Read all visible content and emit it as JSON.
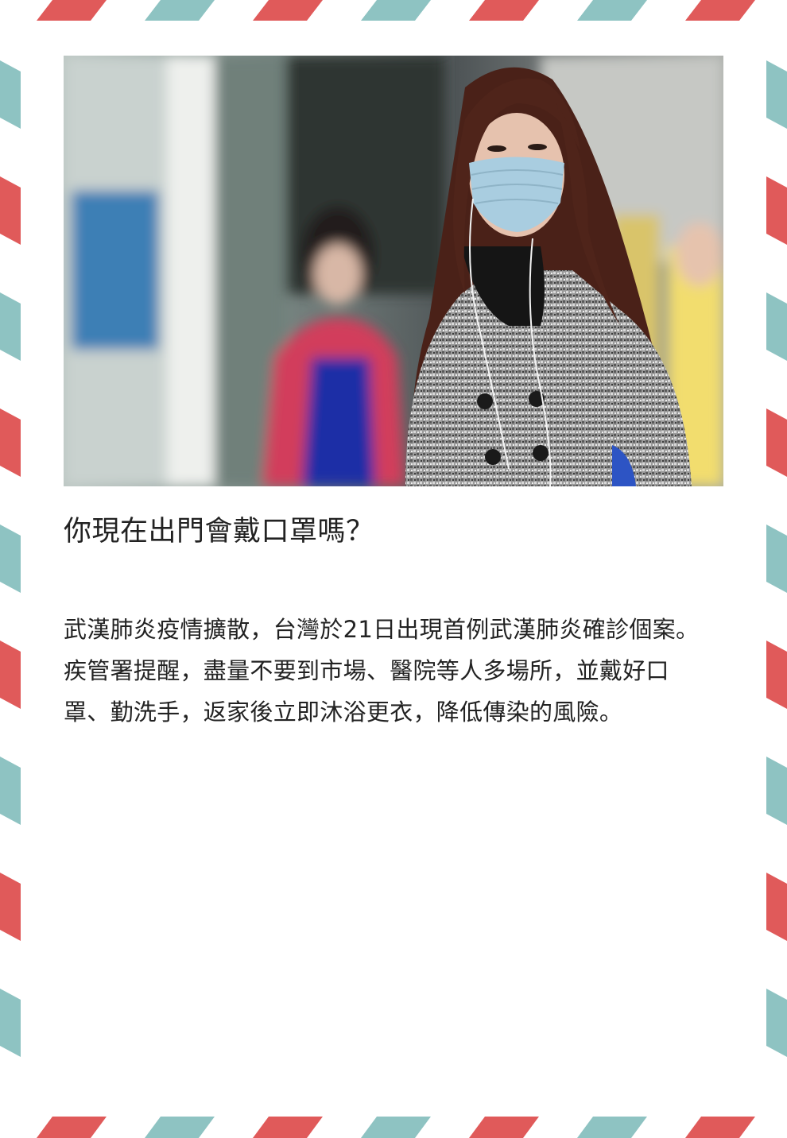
{
  "card": {
    "title": "你現在出門會戴口罩嗎？",
    "body": "武漢肺炎疫情擴散，台灣於21日出現首例武漢肺炎確診個案。疾管署提醒，盡量不要到市場、醫院等人多場所，並戴好口罩、勤洗手，返家後立即沐浴更衣，降低傳染的風險。"
  },
  "photo": {
    "subject": "woman-wearing-surgical-mask"
  },
  "colors": {
    "stripe_red": "#e05a5a",
    "stripe_teal": "#8ec3c2",
    "text": "#222222",
    "background": "#ffffff"
  }
}
